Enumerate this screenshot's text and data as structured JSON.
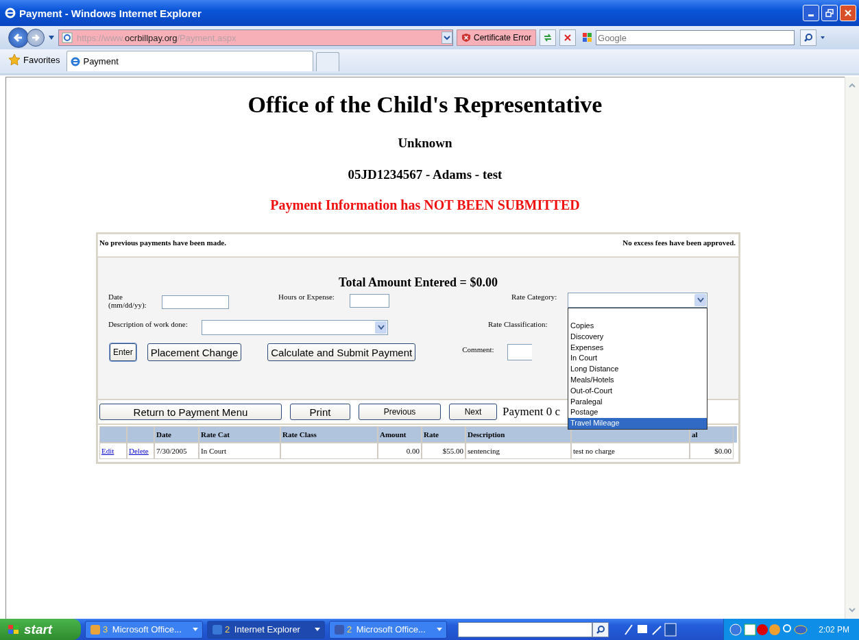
{
  "window": {
    "title": "Payment - Windows Internet Explorer"
  },
  "address_bar": {
    "prefix": "https://www.",
    "domain": "ocrbillpay.org",
    "path": "/Payment.aspx",
    "certificate": "Certificate Error"
  },
  "search": {
    "placeholder": "Google"
  },
  "favorites": {
    "label": "Favorites"
  },
  "tabs": [
    {
      "label": "Payment",
      "selected": true
    }
  ],
  "page": {
    "heading": "Office of the Child's Representative",
    "subheading": "Unknown",
    "case": "05JD1234567 - Adams - test",
    "status": "Payment Information has NOT BEEN SUBMITTED",
    "notice_left": "No previous payments have been made.",
    "notice_right": "No excess fees have been approved.",
    "total": "Total Amount Entered = $0.00",
    "labels": {
      "date": "Date (mm/dd/yy):",
      "hours": "Hours or Expense:",
      "rate_category": "Rate Category:",
      "description": "Description of work done:",
      "rate_classification": "Rate Classification:",
      "comment": "Comment:"
    },
    "buttons": [
      "Enter",
      "Placement Change",
      "Calculate and Submit Payment"
    ],
    "nav_buttons": [
      "Return to Payment Menu",
      "Print",
      "Previous",
      "Next"
    ],
    "payment_counter": "Payment 0 c",
    "rate_category_options": [
      {
        "label": "Copies",
        "selected": false
      },
      {
        "label": "Discovery",
        "selected": false
      },
      {
        "label": "Expenses",
        "selected": false
      },
      {
        "label": "In Court",
        "selected": false
      },
      {
        "label": "Long Distance",
        "selected": false
      },
      {
        "label": "Meals/Hotels",
        "selected": false
      },
      {
        "label": "Out-of-Court",
        "selected": false
      },
      {
        "label": "Paralegal",
        "selected": false
      },
      {
        "label": "Postage",
        "selected": false
      },
      {
        "label": "Travel Mileage",
        "selected": true
      }
    ],
    "table": {
      "columns": [
        "Date",
        "Rate Cat",
        "Rate Class",
        "Amount",
        "Rate",
        "Description",
        "al"
      ],
      "rows": [
        {
          "edit": "Edit",
          "delete": "Delete",
          "cells": [
            "7/30/2005",
            "In Court",
            "",
            "0.00",
            "$55.00",
            "sentencing",
            "test no charge",
            "$0.00"
          ]
        }
      ]
    }
  },
  "taskbar": {
    "start": "start",
    "items": [
      {
        "count": "3",
        "label": "Microsoft Office...",
        "kind": "mail",
        "selected": false
      },
      {
        "count": "2",
        "label": "Internet Explorer",
        "kind": "browser",
        "selected": true
      },
      {
        "count": "2",
        "label": "Microsoft Office...",
        "kind": "word",
        "selected": false
      }
    ],
    "clock": "2:02 PM"
  }
}
